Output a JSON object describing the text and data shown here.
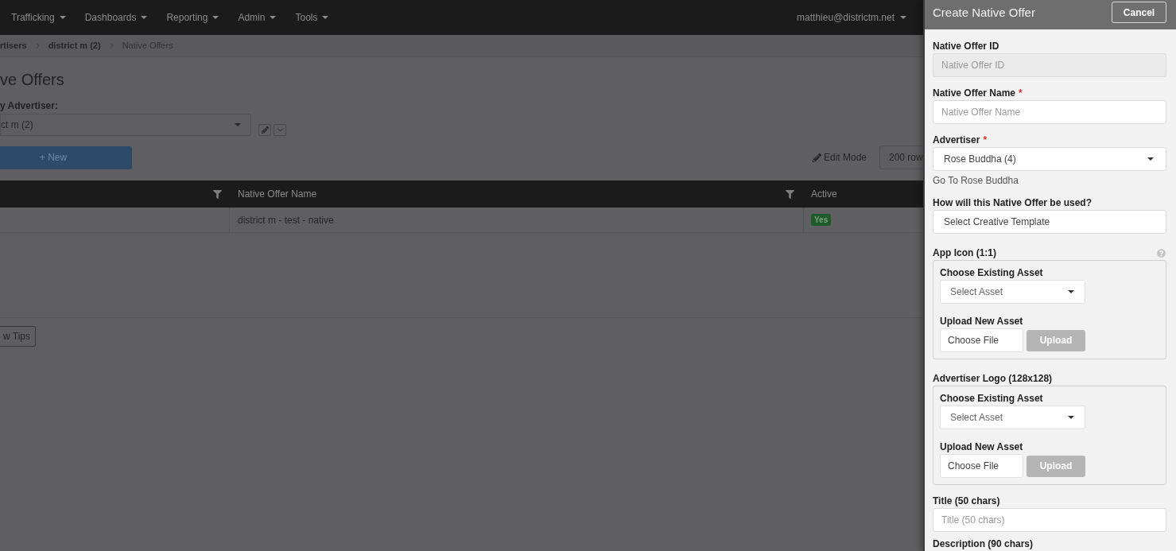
{
  "navbar": {
    "items": [
      {
        "label": "Trafficking",
        "dropdown": true
      },
      {
        "label": "Dashboards",
        "dropdown": true
      },
      {
        "label": "Reporting",
        "dropdown": true
      },
      {
        "label": "Admin",
        "dropdown": true
      },
      {
        "label": "Tools",
        "dropdown": true
      }
    ],
    "user": "matthieu@districtm.net"
  },
  "breadcrumb": [
    {
      "label": "rtisers",
      "current": false
    },
    {
      "label": "district m (2)",
      "current": false
    },
    {
      "label": "Native Offers",
      "current": true
    }
  ],
  "page": {
    "title": "ve Offers",
    "filter_label": "y Advertiser:",
    "advertiser_select": "ct m (2)",
    "new_button": "+ New",
    "edit_mode": "Edit Mode",
    "rows_select": "200 row",
    "tips_button": "w Tips"
  },
  "table": {
    "columns": [
      {
        "filterable": true
      },
      {
        "label": "Native Offer Name",
        "filterable": true
      },
      {
        "label": "Active",
        "filterable": false
      }
    ],
    "rows": [
      {
        "native_offer_name": "district m - test - native",
        "active": "Yes"
      }
    ]
  },
  "panel": {
    "title": "Create Native Offer",
    "cancel_button": "Cancel",
    "fields": [
      {
        "kind": "input",
        "label": "Native Offer ID",
        "placeholder": "Native Offer ID",
        "disabled": true
      },
      {
        "kind": "input",
        "label": "Native Offer Name",
        "required_mark": "*",
        "placeholder": "Native Offer Name",
        "disabled": false
      },
      {
        "kind": "select",
        "label": "Advertiser",
        "required_mark": "*",
        "value": "Rose Buddha (4)",
        "caret": true,
        "link": "Go To Rose Buddha"
      },
      {
        "kind": "select",
        "label": "How will this Native Offer be used?",
        "value": "Select Creative Template",
        "caret": false
      },
      {
        "kind": "asset",
        "label": "App Icon (1:1)",
        "help": true,
        "choose_label": "Choose Existing Asset",
        "select_placeholder": "Select Asset",
        "upload_label": "Upload New Asset",
        "file_button": "Choose File",
        "upload_button": "Upload",
        "upload_disabled": true
      },
      {
        "kind": "asset",
        "label": "Advertiser Logo (128x128)",
        "help": false,
        "choose_label": "Choose Existing Asset",
        "select_placeholder": "Select Asset",
        "upload_label": "Upload New Asset",
        "file_button": "Choose File",
        "upload_button": "Upload",
        "upload_disabled": true
      },
      {
        "kind": "input",
        "label": "Title (50 chars)",
        "placeholder": "Title (50 chars)",
        "disabled": false
      },
      {
        "kind": "heading",
        "label": "Description (90 chars)"
      }
    ]
  }
}
